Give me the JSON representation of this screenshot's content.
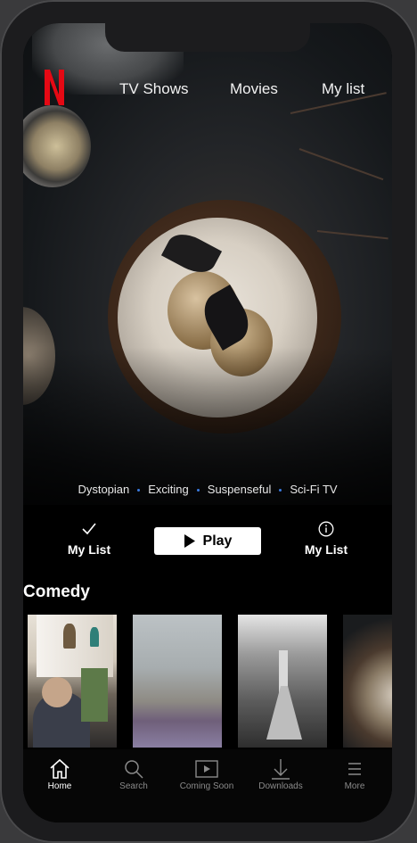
{
  "nav": {
    "tv_shows": "TV Shows",
    "movies": "Movies",
    "my_list": "My list"
  },
  "brand": {
    "logo_color": "#E50914"
  },
  "hero": {
    "tags": [
      "Dystopian",
      "Exciting",
      "Suspenseful",
      "Sci-Fi TV"
    ],
    "my_list_left": "My List",
    "play": "Play",
    "my_list_right": "My List"
  },
  "row": {
    "title": "Comedy"
  },
  "tabs": [
    {
      "label": "Home",
      "icon": "home-icon"
    },
    {
      "label": "Search",
      "icon": "search-icon"
    },
    {
      "label": "Coming Soon",
      "icon": "coming-soon-icon"
    },
    {
      "label": "Downloads",
      "icon": "download-icon"
    },
    {
      "label": "More",
      "icon": "menu-icon"
    }
  ],
  "colors": {
    "tag_dot": "#3B7BE0",
    "active_tab": "#FFFFFF",
    "inactive_tab": "#8A8A8A"
  }
}
